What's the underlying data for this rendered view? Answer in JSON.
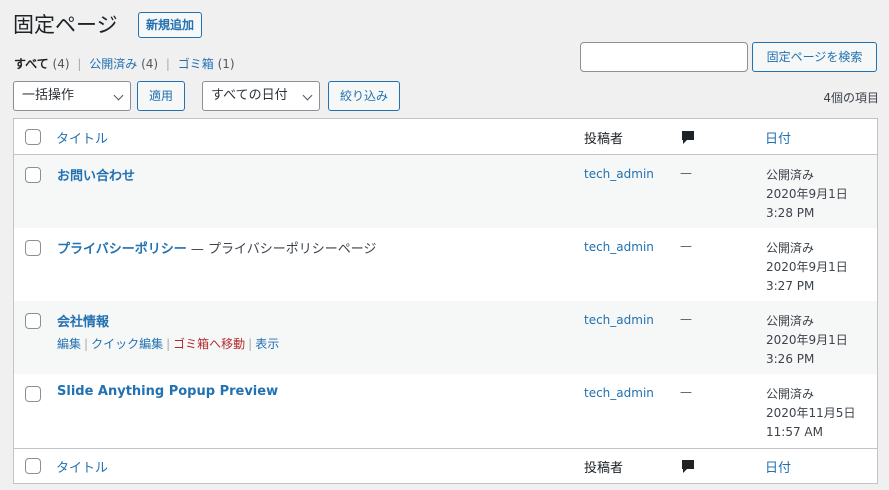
{
  "header": {
    "title": "固定ページ",
    "add_new_label": "新規追加"
  },
  "views": [
    {
      "label": "すべて",
      "count": "(4)"
    },
    {
      "label": "公開済み",
      "count": "(4)"
    },
    {
      "label": "ゴミ箱",
      "count": "(1)"
    }
  ],
  "search": {
    "value": "",
    "button_label": "固定ページを検索"
  },
  "toolbar": {
    "bulk_action": "一括操作",
    "apply_label": "適用",
    "date_filter": "すべての日付",
    "filter_label": "絞り込み",
    "items_count": "4個の項目"
  },
  "table": {
    "columns": {
      "title": "タイトル",
      "author": "投稿者",
      "comments": "comment-bubble-icon",
      "date": "日付"
    },
    "rows": [
      {
        "title": "お問い合わせ",
        "suffix": "",
        "author": "tech_admin",
        "comments": "—",
        "status": "公開済み",
        "date": "2020年9月1日",
        "time": "3:28 PM"
      },
      {
        "title": "プライバシーポリシー",
        "suffix": " — プライバシーポリシーページ",
        "author": "tech_admin",
        "comments": "—",
        "status": "公開済み",
        "date": "2020年9月1日",
        "time": "3:27 PM"
      },
      {
        "title": "会社情報",
        "suffix": "",
        "author": "tech_admin",
        "comments": "—",
        "status": "公開済み",
        "date": "2020年9月1日",
        "time": "3:26 PM",
        "actions": {
          "edit": "編集",
          "quick_edit": "クイック編集",
          "trash": "ゴミ箱へ移動",
          "view": "表示"
        }
      },
      {
        "title": "Slide Anything Popup Preview",
        "suffix": "",
        "author": "tech_admin",
        "comments": "—",
        "status": "公開済み",
        "date": "2020年11月5日",
        "time": "11:57 AM"
      }
    ]
  },
  "colors": {
    "link": "#2271b1",
    "trash": "#b32d2e",
    "background": "#f0f0f1"
  }
}
